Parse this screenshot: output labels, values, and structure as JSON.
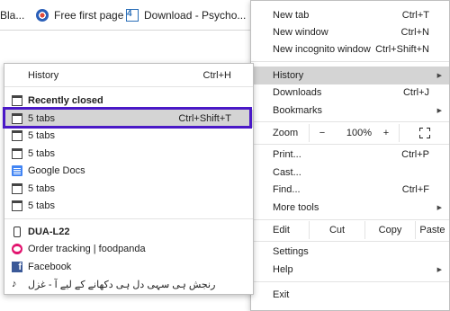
{
  "bookmarks": [
    {
      "label": "Bla...",
      "icon": "folder-icon"
    },
    {
      "label": "Free first page",
      "icon": "flag-icon"
    },
    {
      "label": "Download - Psycho...",
      "icon": "number-4-icon"
    }
  ],
  "main_menu": {
    "new_tab": {
      "label": "New tab",
      "shortcut": "Ctrl+T"
    },
    "new_window": {
      "label": "New window",
      "shortcut": "Ctrl+N"
    },
    "new_incognito": {
      "label": "New incognito window",
      "shortcut": "Ctrl+Shift+N"
    },
    "history": {
      "label": "History"
    },
    "downloads": {
      "label": "Downloads",
      "shortcut": "Ctrl+J"
    },
    "bookmarks": {
      "label": "Bookmarks"
    },
    "zoom": {
      "label": "Zoom",
      "minus": "−",
      "value": "100%",
      "plus": "+"
    },
    "print": {
      "label": "Print...",
      "shortcut": "Ctrl+P"
    },
    "cast": {
      "label": "Cast..."
    },
    "find": {
      "label": "Find...",
      "shortcut": "Ctrl+F"
    },
    "more_tools": {
      "label": "More tools"
    },
    "edit": {
      "label": "Edit",
      "cut": "Cut",
      "copy": "Copy",
      "paste": "Paste"
    },
    "settings": {
      "label": "Settings"
    },
    "help": {
      "label": "Help"
    },
    "exit": {
      "label": "Exit"
    }
  },
  "history_menu": {
    "history": {
      "label": "History",
      "shortcut": "Ctrl+H"
    },
    "recently_closed": "Recently closed",
    "closed_items": [
      {
        "label": "5 tabs",
        "shortcut": "Ctrl+Shift+T",
        "icon": "tab-icon"
      },
      {
        "label": "5 tabs",
        "shortcut": "",
        "icon": "tab-icon"
      },
      {
        "label": "5 tabs",
        "shortcut": "",
        "icon": "tab-icon"
      },
      {
        "label": "Google Docs",
        "shortcut": "",
        "icon": "google-docs-icon"
      },
      {
        "label": "5 tabs",
        "shortcut": "",
        "icon": "tab-icon"
      },
      {
        "label": "5 tabs",
        "shortcut": "",
        "icon": "tab-icon"
      }
    ],
    "device": "DUA-L22",
    "device_items": [
      {
        "label": "Order tracking | foodpanda",
        "icon": "foodpanda-icon"
      },
      {
        "label": "Facebook",
        "icon": "facebook-icon"
      },
      {
        "label": "رنجش ہی سہی دل ہی دکھانے کے لیے آ - غزل",
        "icon": "music-icon"
      }
    ]
  },
  "colors": {
    "highlight": "#d4d4d4",
    "focus_box": "#4a19c7"
  }
}
